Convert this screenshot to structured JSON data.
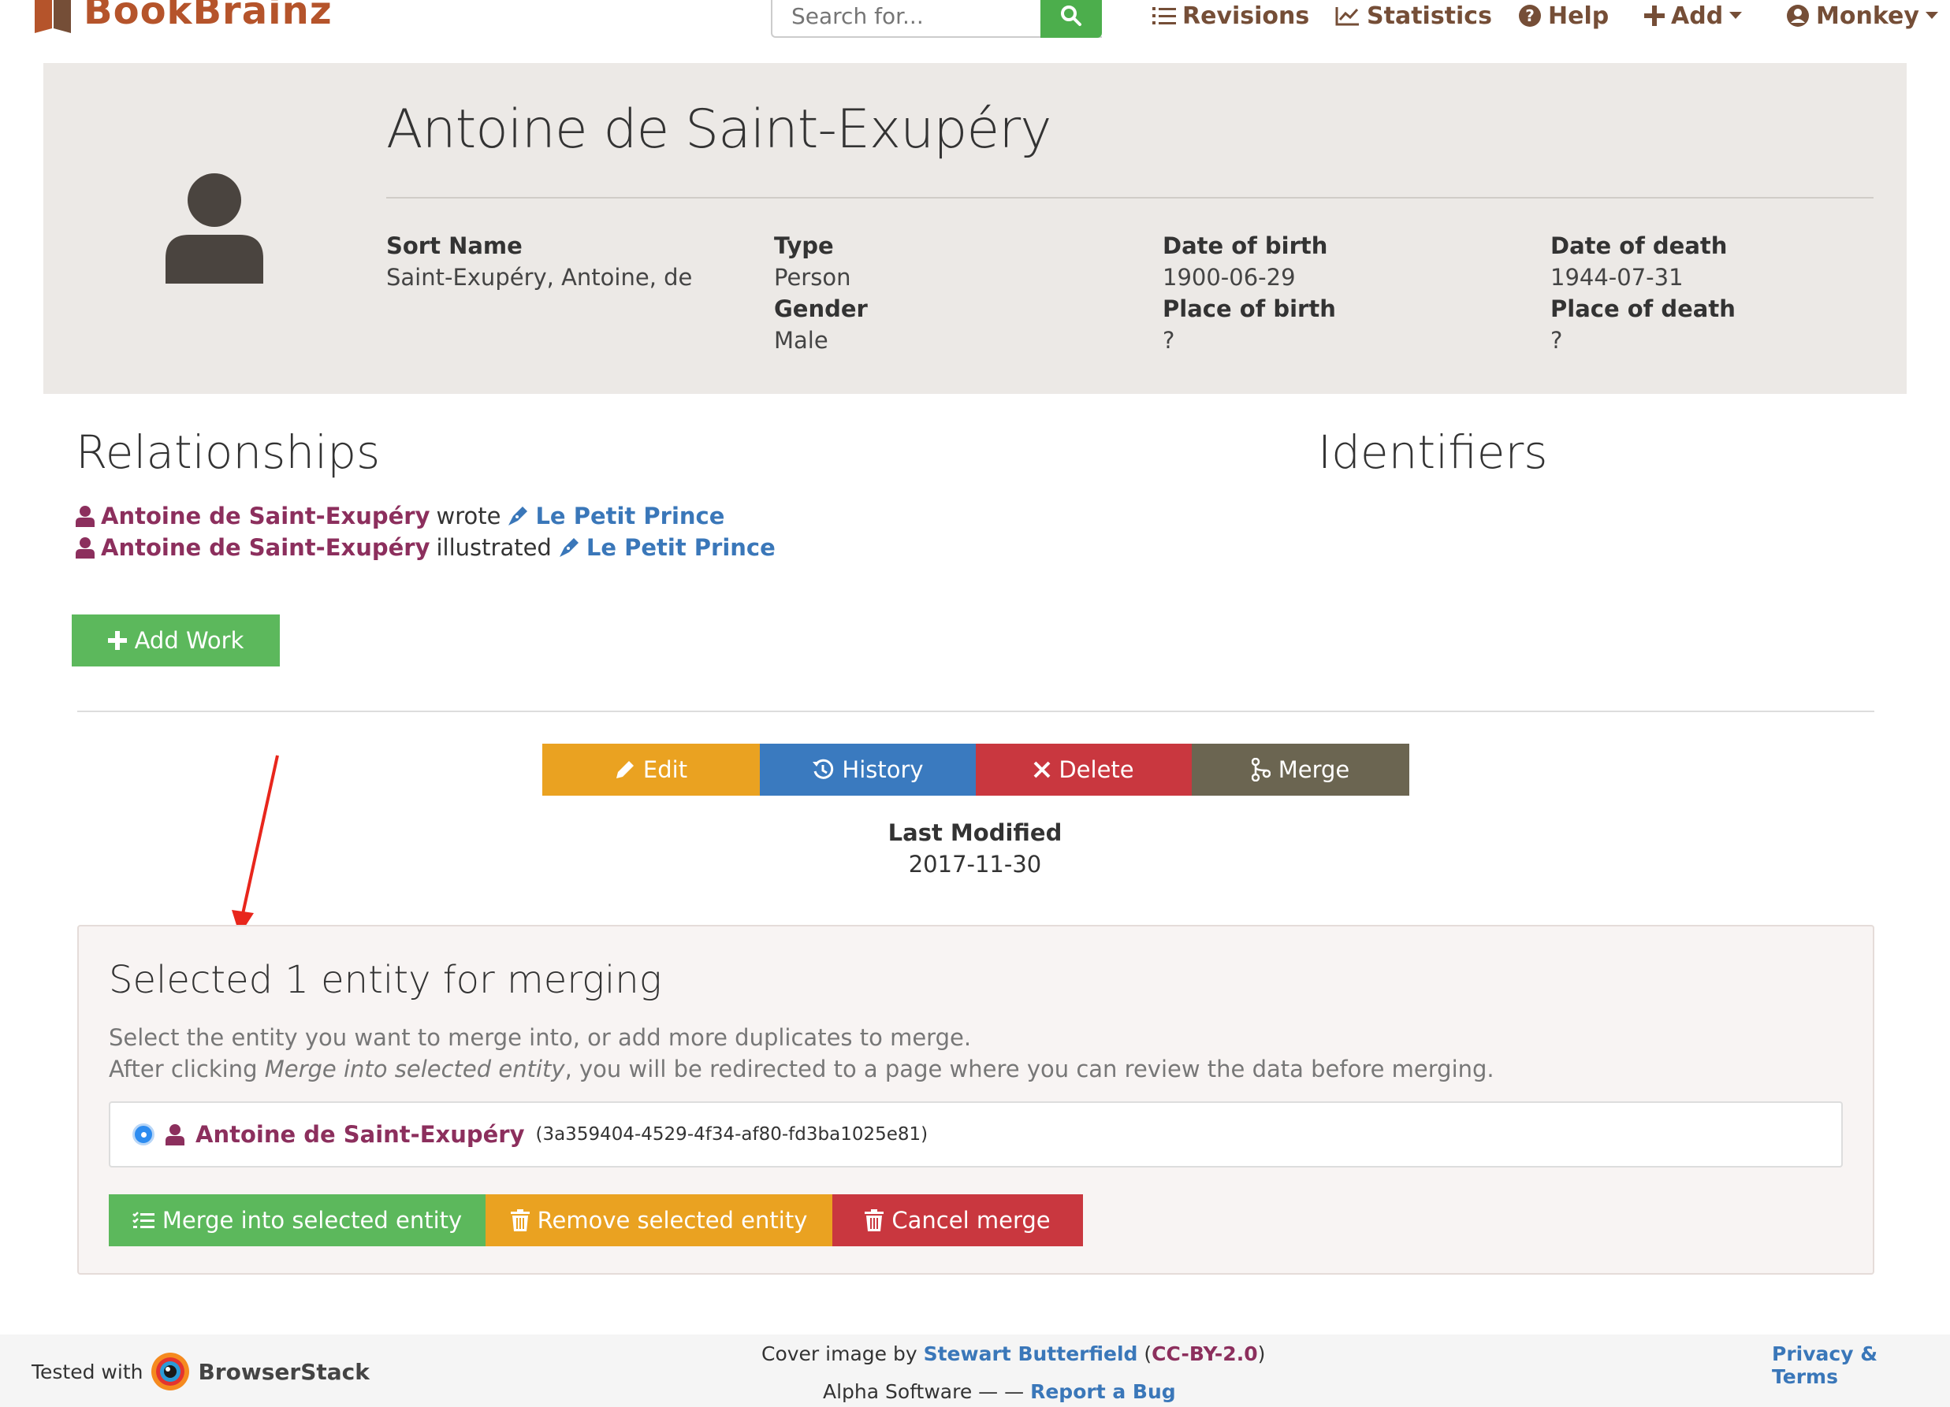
{
  "nav": {
    "brand": "BookBrainz",
    "search_placeholder": "Search for...",
    "revisions": "Revisions",
    "statistics": "Statistics",
    "help": "Help",
    "add": "Add",
    "user": "Monkey"
  },
  "entity": {
    "title": "Antoine de Saint-Exupéry",
    "sort_name_label": "Sort Name",
    "sort_name": "Saint-Exupéry, Antoine, de",
    "type_label": "Type",
    "type": "Person",
    "gender_label": "Gender",
    "gender": "Male",
    "dob_label": "Date of birth",
    "dob": "1900-06-29",
    "pob_label": "Place of birth",
    "pob": "?",
    "dod_label": "Date of death",
    "dod": "1944-07-31",
    "pod_label": "Place of death",
    "pod": "?"
  },
  "relationships": {
    "title": "Relationships",
    "items": [
      {
        "entity": "Antoine de Saint-Exupéry",
        "verb": "wrote",
        "work": "Le Petit Prince"
      },
      {
        "entity": "Antoine de Saint-Exupéry",
        "verb": "illustrated",
        "work": "Le Petit Prince"
      }
    ],
    "add_work": "Add Work"
  },
  "identifiers": {
    "title": "Identifiers"
  },
  "actions": {
    "edit": "Edit",
    "history": "History",
    "delete": "Delete",
    "merge": "Merge"
  },
  "last_modified": {
    "label": "Last Modified",
    "value": "2017-11-30"
  },
  "merge": {
    "title": "Selected 1 entity for merging",
    "desc1": "Select the entity you want to merge into, or add more duplicates to merge.",
    "desc2_prefix": "After clicking ",
    "desc2_em": "Merge into selected entity",
    "desc2_suffix": ", you will be redirected to a page where you can review the data before merging.",
    "entity_name": "Antoine de Saint-Exupéry",
    "entity_bbid": "(3a359404-4529-4f34-af80-fd3ba1025e81)",
    "merge_button": "Merge into selected entity",
    "remove_button": "Remove selected entity",
    "cancel_button": "Cancel merge"
  },
  "footer": {
    "tested_with": "Tested with",
    "browserstack": "BrowserStack",
    "cover_prefix": "Cover image by",
    "cover_author": "Stewart Butterfield",
    "cover_license": "CC-BY-2.0",
    "alpha": "Alpha Software — —",
    "report_bug": "Report a Bug",
    "privacy": "Privacy & Terms"
  },
  "colors": {
    "brand": "#b5542b",
    "nav_text": "#754e37",
    "success": "#5cb85c",
    "warning": "#eaa221",
    "info": "#3a7abf",
    "danger": "#c9373f",
    "merge_gray": "#6b6551",
    "entity_purple": "#8c2f5d",
    "link_blue": "#3a77b9"
  }
}
